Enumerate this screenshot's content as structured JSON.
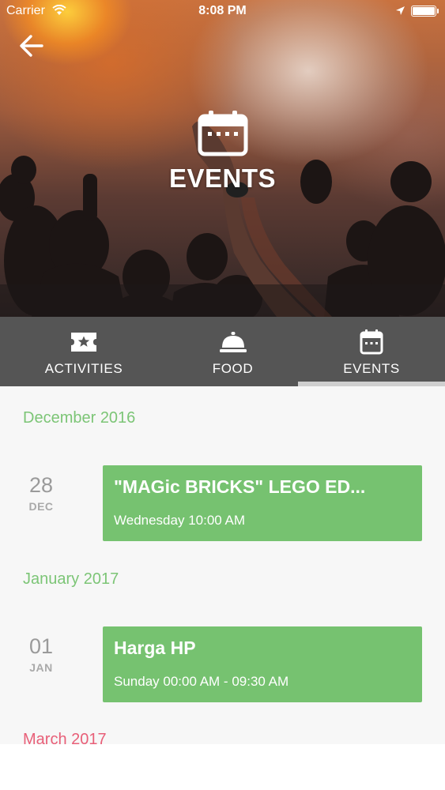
{
  "status_bar": {
    "carrier": "Carrier",
    "time": "8:08 PM",
    "icons": [
      "wifi-icon",
      "location-arrow-icon",
      "battery-icon"
    ]
  },
  "header": {
    "back_icon": "arrow-left-icon",
    "title": "EVENTS",
    "title_icon": "calendar-icon"
  },
  "tabs": [
    {
      "label": "ACTIVITIES",
      "icon": "ticket-star-icon",
      "selected": false
    },
    {
      "label": "FOOD",
      "icon": "food-cloche-icon",
      "selected": false
    },
    {
      "label": "EVENTS",
      "icon": "calendar-icon",
      "selected": true
    }
  ],
  "sections": [
    {
      "month": "December 2016",
      "events": [
        {
          "day": "28",
          "mon": "DEC",
          "title": "\"MAGic BRICKS\" LEGO ED...",
          "time": "Wednesday 10:00 AM"
        }
      ]
    },
    {
      "month": "January 2017",
      "events": [
        {
          "day": "01",
          "mon": "JAN",
          "title": "Harga HP",
          "time": "Sunday 00:00 AM - 09:30 AM"
        }
      ]
    },
    {
      "month": "March 2017",
      "events": []
    }
  ],
  "colors": {
    "accent_green": "#76c270",
    "month_green": "#7cc576",
    "month_pink": "#e85f78",
    "tabbar_bg": "#555555"
  }
}
